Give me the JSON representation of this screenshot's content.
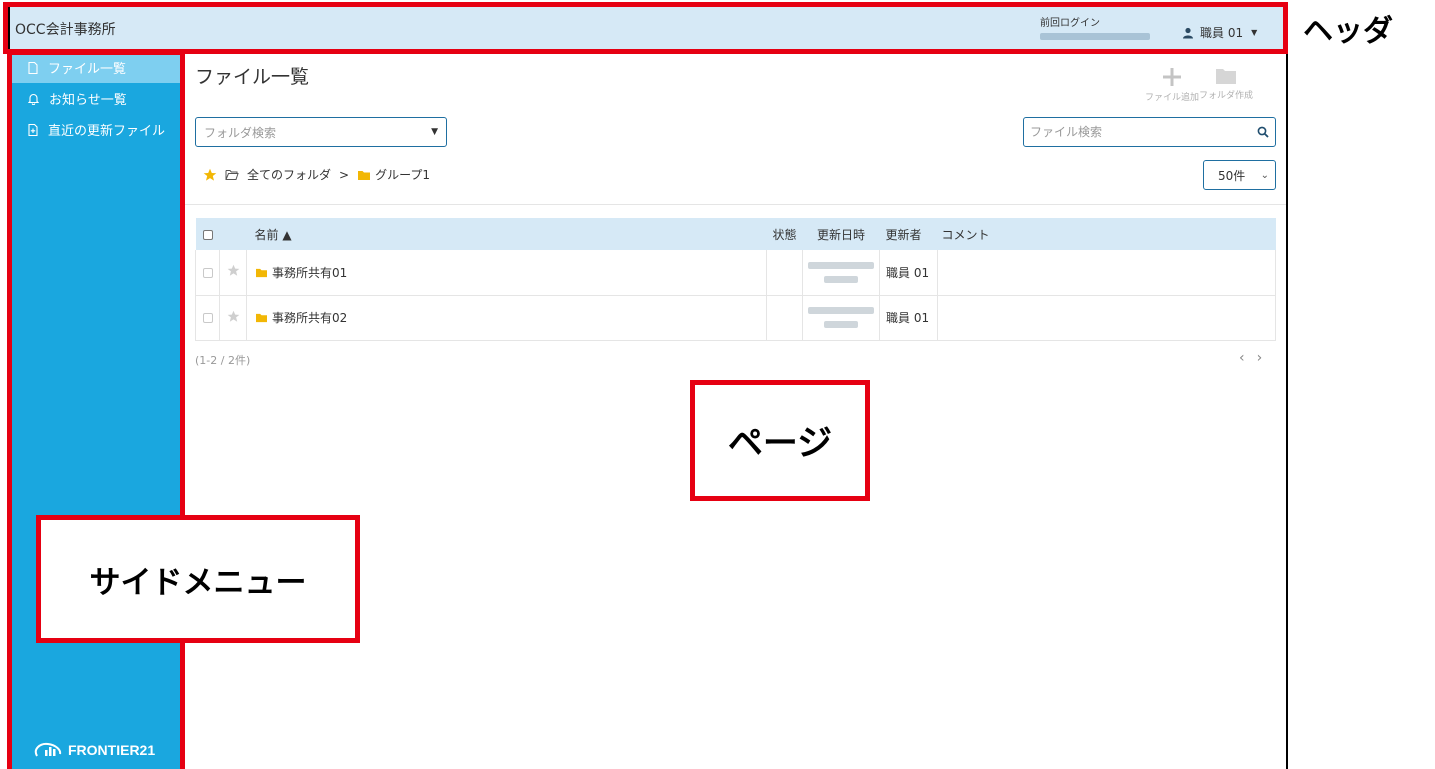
{
  "header": {
    "app_title": "OCC会計事務所",
    "last_login_label": "前回ログイン",
    "user_name": "職員 01",
    "bg": "#d6e9f6"
  },
  "sidebar": {
    "bg": "#1aa7df",
    "items": [
      {
        "label": "ファイル一覧",
        "icon": "file-icon",
        "active": true
      },
      {
        "label": "お知らせ一覧",
        "icon": "bell-icon",
        "active": false
      },
      {
        "label": "直近の更新ファイル",
        "icon": "file-plus-icon",
        "active": false
      }
    ],
    "logo": "FRONTIER21"
  },
  "main": {
    "title": "ファイル一覧",
    "actions": {
      "add_file": "ファイル追加",
      "create_folder": "フォルダ作成"
    },
    "folder_search": {
      "placeholder": "フォルダ検索"
    },
    "file_search": {
      "placeholder": "ファイル検索"
    },
    "breadcrumb": {
      "root": "全てのフォルダ",
      "sep": ">",
      "current": "グループ1"
    },
    "page_size": "50件",
    "table": {
      "columns": {
        "name": "名前 ▲",
        "status": "状態",
        "updated_at": "更新日時",
        "updated_by": "更新者",
        "comment": "コメント"
      },
      "rows": [
        {
          "name": "事務所共有01",
          "updated_by": "職員 01"
        },
        {
          "name": "事務所共有02",
          "updated_by": "職員 01"
        }
      ]
    },
    "count_text": "(1-2 / 2件)"
  },
  "annotations": {
    "header": "ヘッダ",
    "page": "ページ",
    "side_menu": "サイドメニュー",
    "color": "#e60012"
  }
}
